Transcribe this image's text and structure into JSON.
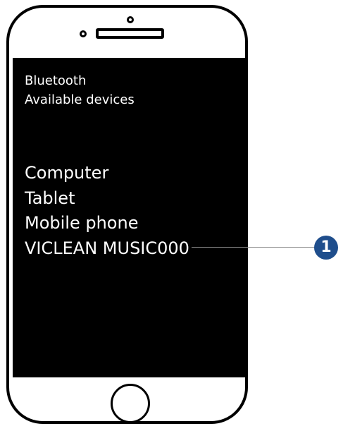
{
  "screen": {
    "header": "Bluetooth",
    "subheader": "Available devices",
    "devices": [
      "Computer",
      "Tablet",
      "Mobile phone",
      "VICLEAN MUSIC000"
    ]
  },
  "callout": {
    "number": "1",
    "color": "#1f4e8c"
  },
  "icons": {
    "camera": "camera-icon",
    "sensor": "sensor-icon",
    "speaker": "speaker-icon",
    "home": "home-button-icon"
  }
}
